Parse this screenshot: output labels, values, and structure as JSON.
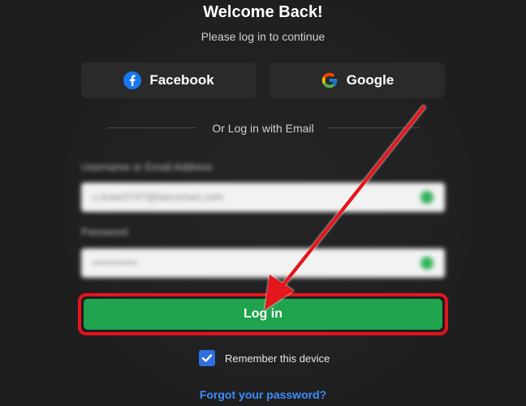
{
  "header": {
    "title": "Welcome Back!",
    "subtitle": "Please log in to continue"
  },
  "social": {
    "facebook_label": "Facebook",
    "google_label": "Google"
  },
  "divider": {
    "text": "Or Log in with Email"
  },
  "form": {
    "username_label": "Username or Email Address",
    "username_value": "c.lowe3747@bacomart.com",
    "password_label": "Password",
    "password_value": "••••••••••••",
    "login_label": "Log in",
    "remember_label": "Remember this device",
    "remember_checked": true,
    "forgot_label": "Forgot your password?"
  },
  "colors": {
    "background": "#1e1e1f",
    "login_green": "#1fa34d",
    "highlight_red": "#e5131c",
    "link_blue": "#3b8cff",
    "checkbox_blue": "#2d6fe0"
  },
  "icons": {
    "facebook": "facebook-icon",
    "google": "google-icon",
    "check": "check-icon",
    "annotation_arrow": "arrow-icon"
  }
}
